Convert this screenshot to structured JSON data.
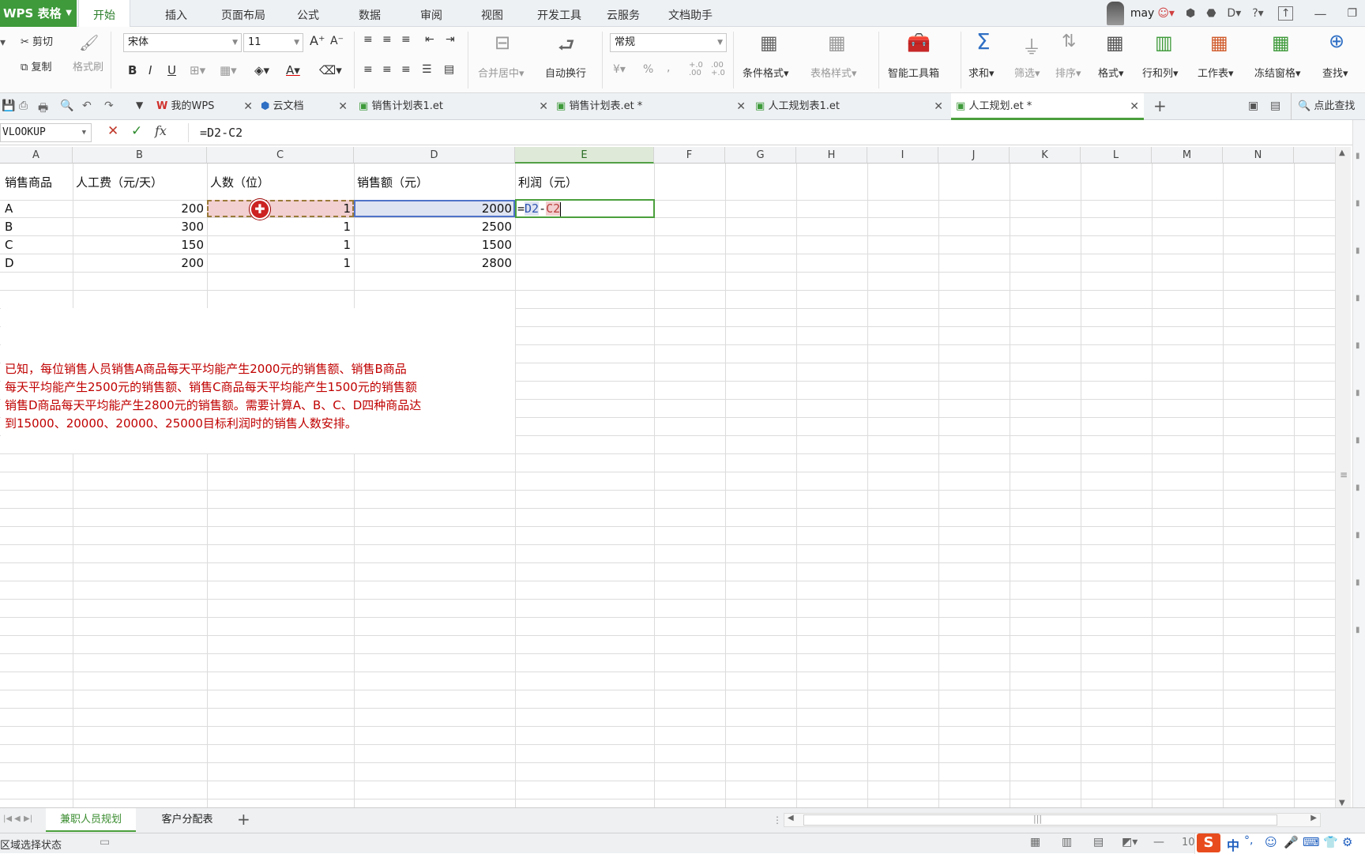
{
  "app": {
    "title": "WPS 表格"
  },
  "menu": {
    "tabs": [
      "开始",
      "插入",
      "页面布局",
      "公式",
      "数据",
      "审阅",
      "视图",
      "开发工具",
      "云服务",
      "文档助手"
    ],
    "active": "开始"
  },
  "user": {
    "name": "may"
  },
  "ribbon": {
    "cut": "剪切",
    "copy": "复制",
    "format_painter": "格式刷",
    "font_name": "宋体",
    "font_size": "11",
    "merge_center": "合并居中",
    "wrap_text": "自动换行",
    "number_format": "常规",
    "conditional_format": "条件格式",
    "table_style": "表格样式",
    "smart_toolbox": "智能工具箱",
    "sum": "求和",
    "filter": "筛选",
    "sort": "排序",
    "format": "格式",
    "row_col": "行和列",
    "worksheet": "工作表",
    "freeze": "冻结窗格",
    "find": "查找"
  },
  "doc_tabs": {
    "items": [
      "我的WPS",
      "云文档",
      "销售计划表1.et",
      "销售计划表.et *",
      "人工规划表1.et",
      "人工规划.et *"
    ],
    "search": "点此查找"
  },
  "formula_bar": {
    "name_box": "VLOOKUP",
    "fx": "fx",
    "formula": "=D2-C2"
  },
  "columns": [
    "A",
    "B",
    "C",
    "D",
    "E",
    "F",
    "G",
    "H",
    "I",
    "J",
    "K",
    "L",
    "M",
    "N"
  ],
  "table": {
    "headers": [
      "销售商品",
      "人工费（元/天）",
      "人数（位）",
      "销售额（元）",
      "利润（元）"
    ],
    "rows": [
      {
        "product": "A",
        "cost": "200",
        "count": "1",
        "sales": "2000"
      },
      {
        "product": "B",
        "cost": "300",
        "count": "1",
        "sales": "2500"
      },
      {
        "product": "C",
        "cost": "150",
        "count": "1",
        "sales": "1500"
      },
      {
        "product": "D",
        "cost": "200",
        "count": "1",
        "sales": "2800"
      }
    ],
    "editing_cell": {
      "eq": "=",
      "ref1": "D2",
      "op": "-",
      "ref2": "C2"
    }
  },
  "note_lines": [
    "已知，每位销售人员销售A商品每天平均能产生2000元的销售额、销售B商品",
    "每天平均能产生2500元的销售额、销售C商品每天平均能产生1500元的销售额",
    "销售D商品每天平均能产生2800元的销售额。需要计算A、B、C、D四种商品达",
    "到15000、20000、20000、25000目标利润时的销售人数安排。"
  ],
  "sheets": {
    "tabs": [
      "兼职人员规划",
      "客户分配表"
    ],
    "active": "兼职人员规划"
  },
  "status": {
    "text": "区域选择状态",
    "zoom": "10",
    "ime": "中"
  },
  "colors": {
    "accent": "#3e9a3a",
    "note": "#c00000",
    "ref1": "#4472c4",
    "ref2": "#c0504d"
  }
}
